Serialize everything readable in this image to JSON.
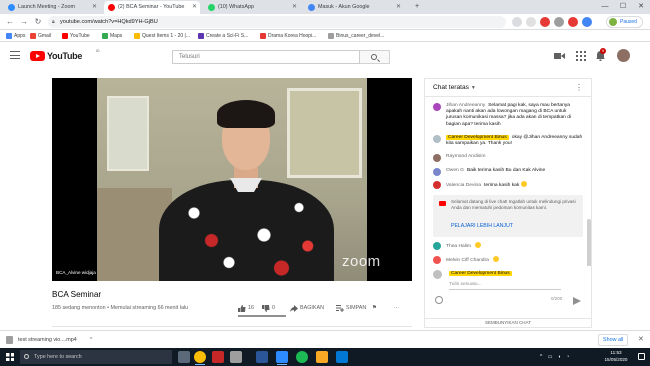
{
  "tabs": [
    {
      "label": "Launch Meeting - Zoom",
      "color": "#2d8cff"
    },
    {
      "label": "(2) BCA Seminar - YouTube",
      "color": "#ff0000",
      "active": true
    },
    {
      "label": "(10) WhatsApp",
      "color": "#25d366"
    },
    {
      "label": "Masuk - Akun Google",
      "color": "#4285f4"
    }
  ],
  "window": {
    "minimize": "—",
    "maximize": "☐",
    "close": "✕",
    "new_tab": "+"
  },
  "address": {
    "url": "youtube.com/watch?v=HQkd9YH-GjBU",
    "paused": "Paused"
  },
  "bookmarks": [
    {
      "label": "Apps",
      "color": "#4285f4"
    },
    {
      "label": "Gmail",
      "color": "#ea4335"
    },
    {
      "label": "YouTube",
      "color": "#ff0000"
    },
    {
      "label": "Maps",
      "color": "#34a853"
    },
    {
      "label": "Quest Items 1 - 20 |...",
      "color": "#fbbc05"
    },
    {
      "label": "Create a Sci-Fi S...",
      "color": "#5e35b1"
    },
    {
      "label": "Drama Korea Hoopi...",
      "color": "#e53935"
    },
    {
      "label": "Binus_career_devel...",
      "color": "#9e9e9e"
    }
  ],
  "youtube": {
    "logo_text": "YouTube",
    "logo_sup": "ID",
    "search_placeholder": "Telusuri",
    "notif_count": "9"
  },
  "video": {
    "title": "BCA Seminar",
    "meta": "185 sedang menonton • Memulai streaming 66 menit lalu",
    "likes": "16",
    "dislikes": "0",
    "share": "BAGIKAN",
    "save": "SIMPAN",
    "more": "⚑",
    "dots": "···",
    "participant_name": "BCA_Alvine widjaja",
    "watermark": "zoom",
    "like_ratio": 1.0
  },
  "chat": {
    "header": "Chat teratas",
    "messages": [
      {
        "author": "Jihan Andreeanny",
        "text": "Selamat pagi kak, saya mau bertanya apakah nanti akan ada lowongan magang di BCA untuk jurusan komunikasi massa? jika ada akan di tempatkan di bagian apa? terima kasih",
        "avatar": "#ab47bc",
        "owner": false
      },
      {
        "author": "Career Development Binus",
        "text": "okay @Jihan Andreeanny sudah kita sampaikan ya. Thank you!",
        "avatar": "#b0bec5",
        "owner": true
      },
      {
        "author": "Raymond Andisim",
        "text": "",
        "avatar": "#8d6e63",
        "owner": false
      },
      {
        "author": "Owen G",
        "text": "Baik terima kasih Bu dan Kak Alvine",
        "avatar": "#7986cb",
        "owner": false
      },
      {
        "author": "Valencia Devina",
        "text": "terima kasih kak",
        "avatar": "#d32f2f",
        "owner": false,
        "emoji": true
      },
      {
        "author": "Thea Halim",
        "text": "",
        "avatar": "#26a69a",
        "owner": false,
        "emoji": true
      },
      {
        "author": "Melvin Ciff Chandra",
        "text": "",
        "avatar": "#ef5350",
        "owner": false,
        "emoji": true
      }
    ],
    "notice": {
      "text": "Selamat datang di live chat! Ingatlah untuk melindungi privasi Anda dan mematuhi pedoman komunitas kami.",
      "link": "PELAJARI LEBIH LANJUT"
    },
    "composer": {
      "owner": "Career Development Binus",
      "placeholder": "Tulis sesuatu...",
      "count": "0/200"
    },
    "hide": "SEMBUNYIKAN CHAT"
  },
  "downloads": {
    "file": "test streaming vio....mp4",
    "show_all": "Show all",
    "close": "✕"
  },
  "taskbar": {
    "search": "Type here to search",
    "time": "11:53",
    "date": "15/05/2020",
    "apps": [
      {
        "name": "task-view",
        "color": "#5a6a7a"
      },
      {
        "name": "chrome",
        "color": "#fbbc05"
      },
      {
        "name": "app-red",
        "color": "#c62828"
      },
      {
        "name": "settings",
        "color": "#9e9e9e"
      },
      {
        "name": "word",
        "color": "#2b579a"
      },
      {
        "name": "zoom",
        "color": "#2d8cff"
      },
      {
        "name": "spotify",
        "color": "#1db954"
      },
      {
        "name": "explorer",
        "color": "#f9a825"
      },
      {
        "name": "mail",
        "color": "#0078d4"
      }
    ]
  }
}
